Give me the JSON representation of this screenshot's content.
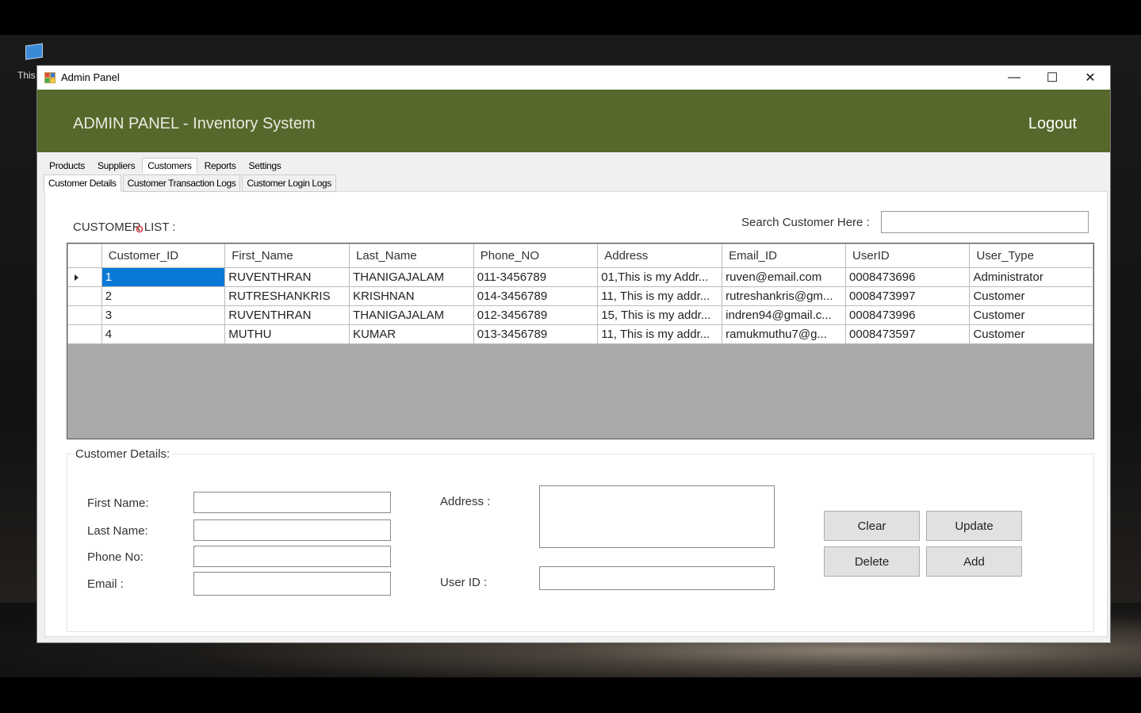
{
  "desktop": {
    "icon_label": "This"
  },
  "window": {
    "title": "Admin Panel",
    "controls": {
      "minimize": "—",
      "maximize": "☐",
      "close": "✕"
    }
  },
  "banner": {
    "title": "ADMIN PANEL - Inventory System",
    "logout": "Logout",
    "color": "#56682b"
  },
  "tabs": [
    "Products",
    "Suppliers",
    "Customers",
    "Reports",
    "Settings"
  ],
  "subtabs": [
    "Customer Details",
    "Customer Transaction Logs",
    "Customer Login Logs"
  ],
  "customer_list": {
    "label": "CUSTOMER LIST :",
    "search_label": "Search Customer Here :",
    "search_value": "",
    "columns": [
      "Customer_ID",
      "First_Name",
      "Last_Name",
      "Phone_NO",
      "Address",
      "Email_ID",
      "UserID",
      "User_Type"
    ],
    "rows": [
      [
        "1",
        "RUVENTHRAN",
        "THANIGAJALAM",
        "011-3456789",
        "01,This is my Addr...",
        "ruven@email.com",
        "0008473696",
        "Administrator"
      ],
      [
        "2",
        "RUTRESHANKRIS",
        "KRISHNAN",
        "014-3456789",
        "11, This is my addr...",
        "rutreshankris@gm...",
        "0008473997",
        "Customer"
      ],
      [
        "3",
        "RUVENTHRAN",
        "THANIGAJALAM",
        "012-3456789",
        "15, This is my addr...",
        "indren94@gmail.c...",
        "0008473996",
        "Customer"
      ],
      [
        "4",
        "MUTHU",
        "KUMAR",
        "013-3456789",
        "11, This is my addr...",
        "ramukmuthu7@g...",
        "0008473597",
        "Customer"
      ]
    ]
  },
  "details": {
    "title": "Customer Details:",
    "first_name_label": "First Name:",
    "last_name_label": "Last Name:",
    "phone_label": "Phone No:",
    "email_label": "Email :",
    "address_label": "Address :",
    "userid_label": "User ID :",
    "buttons": {
      "clear": "Clear",
      "update": "Update",
      "delete": "Delete",
      "add": "Add"
    }
  }
}
